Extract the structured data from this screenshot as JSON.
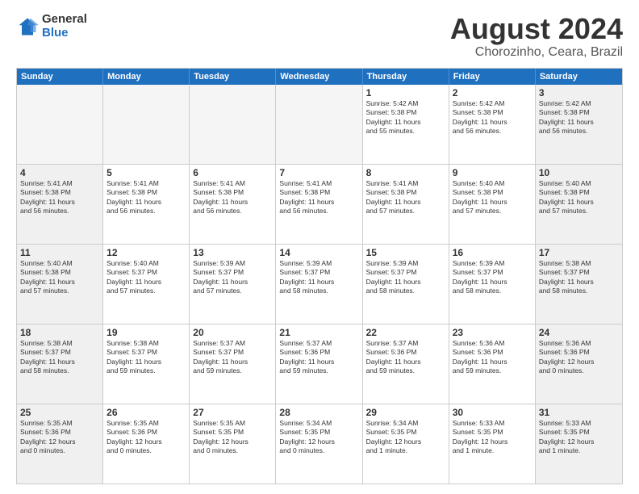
{
  "logo": {
    "general": "General",
    "blue": "Blue"
  },
  "title": "August 2024",
  "subtitle": "Chorozinho, Ceara, Brazil",
  "days_of_week": [
    "Sunday",
    "Monday",
    "Tuesday",
    "Wednesday",
    "Thursday",
    "Friday",
    "Saturday"
  ],
  "rows": [
    [
      {
        "day": "",
        "info": "",
        "empty": true
      },
      {
        "day": "",
        "info": "",
        "empty": true
      },
      {
        "day": "",
        "info": "",
        "empty": true
      },
      {
        "day": "",
        "info": "",
        "empty": true
      },
      {
        "day": "1",
        "info": "Sunrise: 5:42 AM\nSunset: 5:38 PM\nDaylight: 11 hours\nand 55 minutes."
      },
      {
        "day": "2",
        "info": "Sunrise: 5:42 AM\nSunset: 5:38 PM\nDaylight: 11 hours\nand 56 minutes."
      },
      {
        "day": "3",
        "info": "Sunrise: 5:42 AM\nSunset: 5:38 PM\nDaylight: 11 hours\nand 56 minutes."
      }
    ],
    [
      {
        "day": "4",
        "info": "Sunrise: 5:41 AM\nSunset: 5:38 PM\nDaylight: 11 hours\nand 56 minutes."
      },
      {
        "day": "5",
        "info": "Sunrise: 5:41 AM\nSunset: 5:38 PM\nDaylight: 11 hours\nand 56 minutes."
      },
      {
        "day": "6",
        "info": "Sunrise: 5:41 AM\nSunset: 5:38 PM\nDaylight: 11 hours\nand 56 minutes."
      },
      {
        "day": "7",
        "info": "Sunrise: 5:41 AM\nSunset: 5:38 PM\nDaylight: 11 hours\nand 56 minutes."
      },
      {
        "day": "8",
        "info": "Sunrise: 5:41 AM\nSunset: 5:38 PM\nDaylight: 11 hours\nand 57 minutes."
      },
      {
        "day": "9",
        "info": "Sunrise: 5:40 AM\nSunset: 5:38 PM\nDaylight: 11 hours\nand 57 minutes."
      },
      {
        "day": "10",
        "info": "Sunrise: 5:40 AM\nSunset: 5:38 PM\nDaylight: 11 hours\nand 57 minutes."
      }
    ],
    [
      {
        "day": "11",
        "info": "Sunrise: 5:40 AM\nSunset: 5:38 PM\nDaylight: 11 hours\nand 57 minutes."
      },
      {
        "day": "12",
        "info": "Sunrise: 5:40 AM\nSunset: 5:37 PM\nDaylight: 11 hours\nand 57 minutes."
      },
      {
        "day": "13",
        "info": "Sunrise: 5:39 AM\nSunset: 5:37 PM\nDaylight: 11 hours\nand 57 minutes."
      },
      {
        "day": "14",
        "info": "Sunrise: 5:39 AM\nSunset: 5:37 PM\nDaylight: 11 hours\nand 58 minutes."
      },
      {
        "day": "15",
        "info": "Sunrise: 5:39 AM\nSunset: 5:37 PM\nDaylight: 11 hours\nand 58 minutes."
      },
      {
        "day": "16",
        "info": "Sunrise: 5:39 AM\nSunset: 5:37 PM\nDaylight: 11 hours\nand 58 minutes."
      },
      {
        "day": "17",
        "info": "Sunrise: 5:38 AM\nSunset: 5:37 PM\nDaylight: 11 hours\nand 58 minutes."
      }
    ],
    [
      {
        "day": "18",
        "info": "Sunrise: 5:38 AM\nSunset: 5:37 PM\nDaylight: 11 hours\nand 58 minutes."
      },
      {
        "day": "19",
        "info": "Sunrise: 5:38 AM\nSunset: 5:37 PM\nDaylight: 11 hours\nand 59 minutes."
      },
      {
        "day": "20",
        "info": "Sunrise: 5:37 AM\nSunset: 5:37 PM\nDaylight: 11 hours\nand 59 minutes."
      },
      {
        "day": "21",
        "info": "Sunrise: 5:37 AM\nSunset: 5:36 PM\nDaylight: 11 hours\nand 59 minutes."
      },
      {
        "day": "22",
        "info": "Sunrise: 5:37 AM\nSunset: 5:36 PM\nDaylight: 11 hours\nand 59 minutes."
      },
      {
        "day": "23",
        "info": "Sunrise: 5:36 AM\nSunset: 5:36 PM\nDaylight: 11 hours\nand 59 minutes."
      },
      {
        "day": "24",
        "info": "Sunrise: 5:36 AM\nSunset: 5:36 PM\nDaylight: 12 hours\nand 0 minutes."
      }
    ],
    [
      {
        "day": "25",
        "info": "Sunrise: 5:35 AM\nSunset: 5:36 PM\nDaylight: 12 hours\nand 0 minutes."
      },
      {
        "day": "26",
        "info": "Sunrise: 5:35 AM\nSunset: 5:36 PM\nDaylight: 12 hours\nand 0 minutes."
      },
      {
        "day": "27",
        "info": "Sunrise: 5:35 AM\nSunset: 5:35 PM\nDaylight: 12 hours\nand 0 minutes."
      },
      {
        "day": "28",
        "info": "Sunrise: 5:34 AM\nSunset: 5:35 PM\nDaylight: 12 hours\nand 0 minutes."
      },
      {
        "day": "29",
        "info": "Sunrise: 5:34 AM\nSunset: 5:35 PM\nDaylight: 12 hours\nand 1 minute."
      },
      {
        "day": "30",
        "info": "Sunrise: 5:33 AM\nSunset: 5:35 PM\nDaylight: 12 hours\nand 1 minute."
      },
      {
        "day": "31",
        "info": "Sunrise: 5:33 AM\nSunset: 5:35 PM\nDaylight: 12 hours\nand 1 minute."
      }
    ]
  ]
}
